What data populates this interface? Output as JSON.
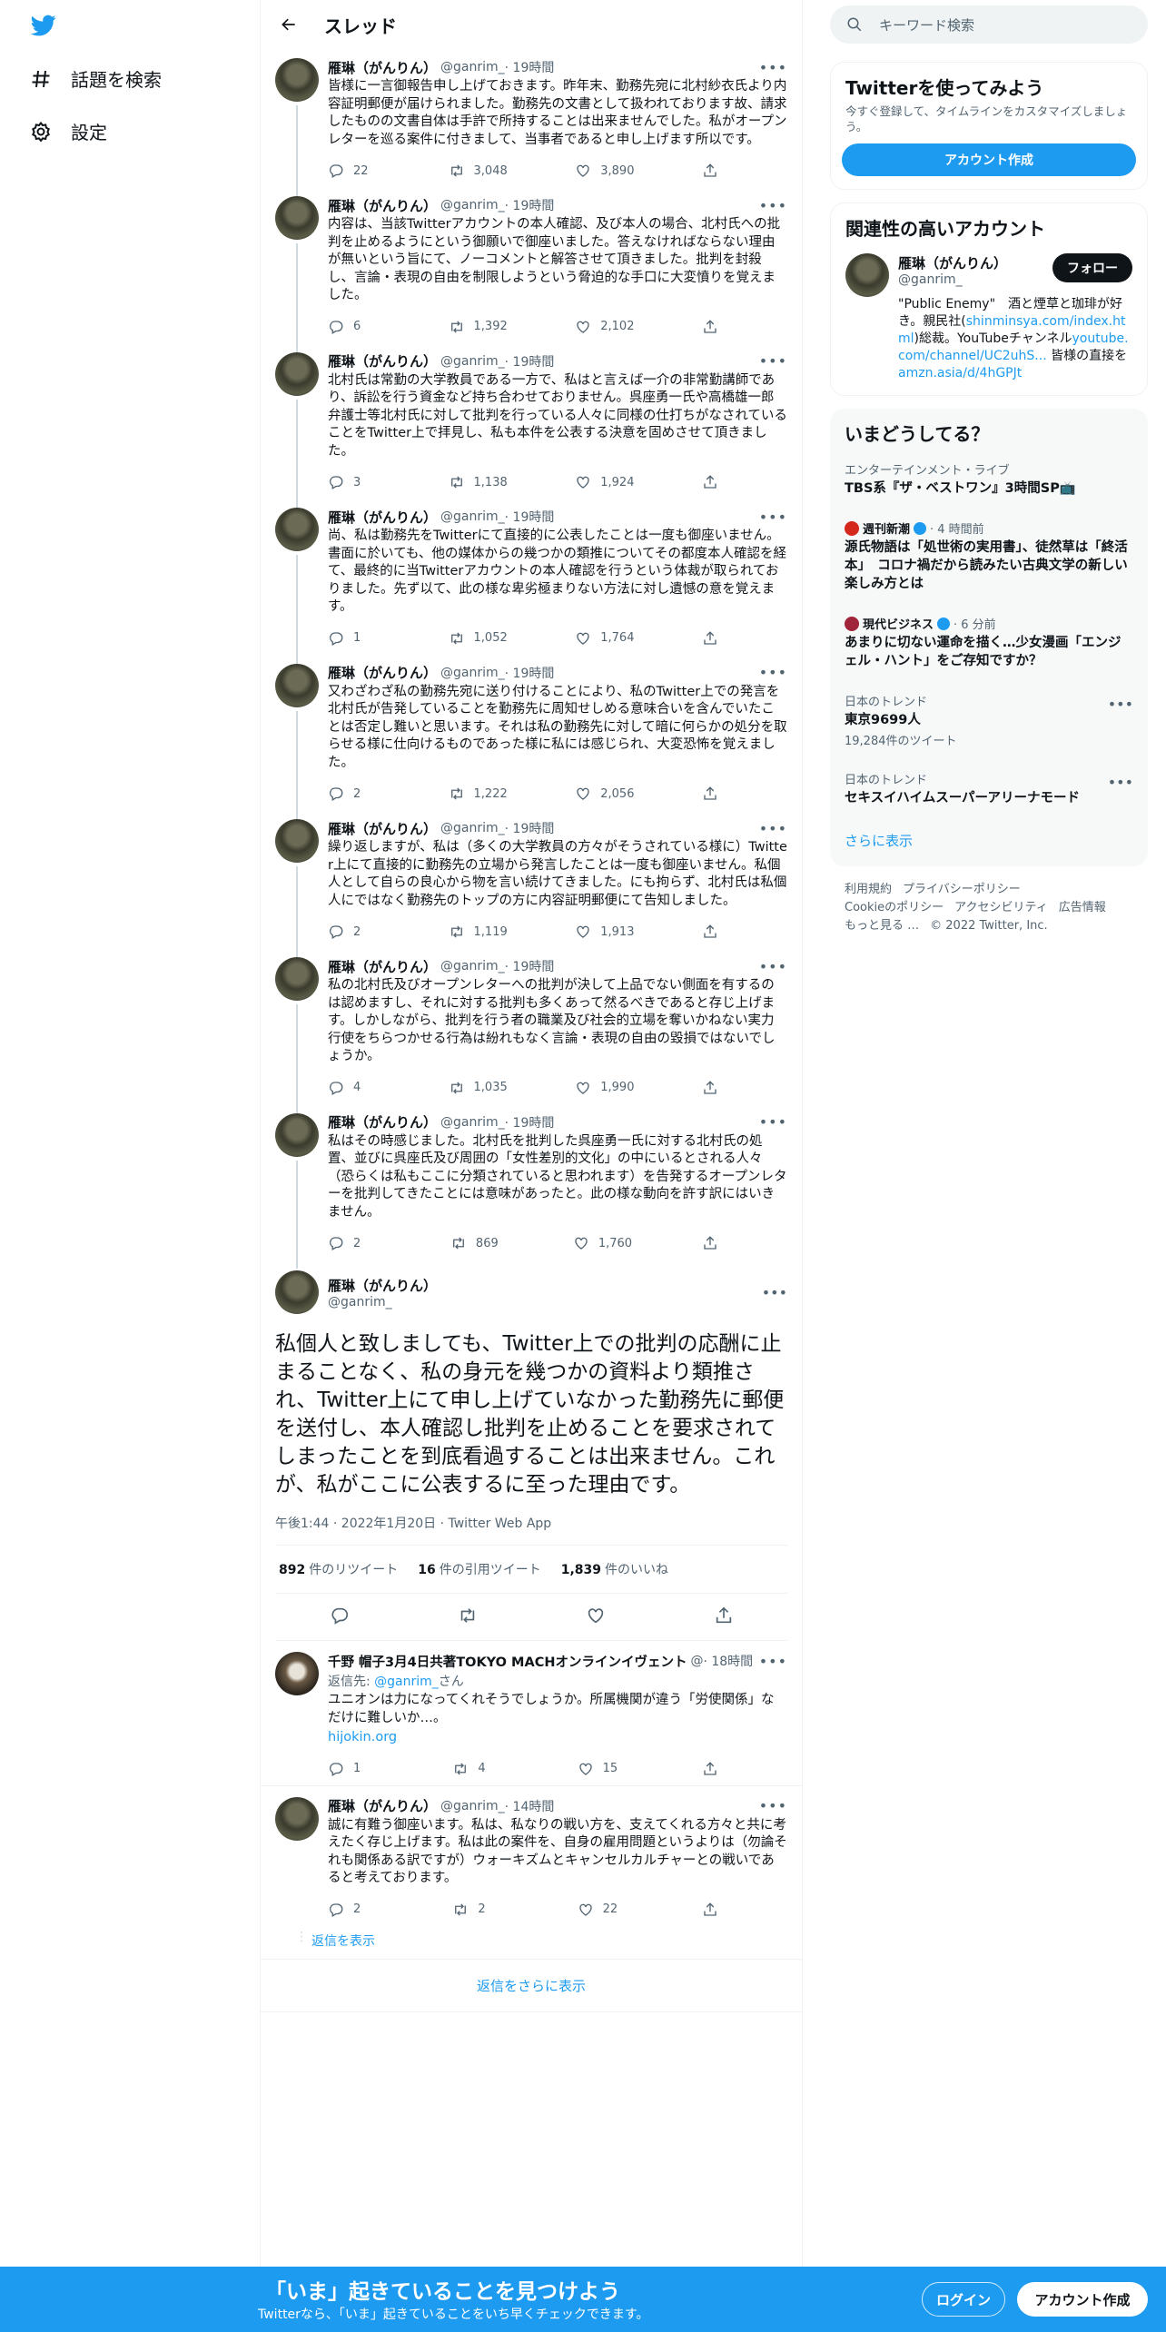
{
  "nav": {
    "explore": "話題を検索",
    "settings": "設定"
  },
  "header": {
    "title": "スレッド"
  },
  "thread": [
    {
      "name": "雁琳（がんりん）",
      "handle": "@ganrim_",
      "time": "· 19時間",
      "text": "皆様に一言御報告申し上げておきます。昨年末、勤務先宛に北村紗衣氏より内容証明郵便が届けられました。勤務先の文書として扱われております故、請求したものの文書自体は手許で所持することは出来ませんでした。私がオープンレターを巡る案件に付きまして、当事者であると申し上げます所以です。",
      "replies": "22",
      "retweets": "3,048",
      "likes": "3,890"
    },
    {
      "name": "雁琳（がんりん）",
      "handle": "@ganrim_",
      "time": "· 19時間",
      "text": "内容は、当該Twitterアカウントの本人確認、及び本人の場合、北村氏への批判を止めるようにという御願いで御座いました。答えなければならない理由が無いという旨にて、ノーコメントと解答させて頂きました。批判を封殺し、言論・表現の自由を制限しようという脅迫的な手口に大変憤りを覚えました。",
      "replies": "6",
      "retweets": "1,392",
      "likes": "2,102"
    },
    {
      "name": "雁琳（がんりん）",
      "handle": "@ganrim_",
      "time": "· 19時間",
      "text": "北村氏は常勤の大学教員である一方で、私はと言えば一介の非常勤講師であり、訴訟を行う資金など持ち合わせておりません。呉座勇一氏や高橋雄一郎弁護士等北村氏に対して批判を行っている人々に同様の仕打ちがなされていることをTwitter上で拝見し、私も本件を公表する決意を固めさせて頂きました。",
      "replies": "3",
      "retweets": "1,138",
      "likes": "1,924"
    },
    {
      "name": "雁琳（がんりん）",
      "handle": "@ganrim_",
      "time": "· 19時間",
      "text": "尚、私は勤務先をTwitterにて直接的に公表したことは一度も御座いません。書面に於いても、他の媒体からの幾つかの類推についてその都度本人確認を経て、最終的に当Twitterアカウントの本人確認を行うという体裁が取られておりました。先ず以て、此の様な卑劣極まりない方法に対し遺憾の意を覚えます。",
      "replies": "1",
      "retweets": "1,052",
      "likes": "1,764"
    },
    {
      "name": "雁琳（がんりん）",
      "handle": "@ganrim_",
      "time": "· 19時間",
      "text": "又わざわざ私の勤務先宛に送り付けることにより、私のTwitter上での発言を北村氏が告発していることを勤務先に周知せしめる意味合いを含んでいたことは否定し難いと思います。それは私の勤務先に対して暗に何らかの処分を取らせる様に仕向けるものであった様に私には感じられ、大変恐怖を覚えました。",
      "replies": "2",
      "retweets": "1,222",
      "likes": "2,056"
    },
    {
      "name": "雁琳（がんりん）",
      "handle": "@ganrim_",
      "time": "· 19時間",
      "text": "繰り返しますが、私は（多くの大学教員の方々がそうされている様に）Twitter上にて直接的に勤務先の立場から発言したことは一度も御座いません。私個人として自らの良心から物を言い続けてきました。にも拘らず、北村氏は私個人にではなく勤務先のトップの方に内容証明郵便にて告知しました。",
      "replies": "2",
      "retweets": "1,119",
      "likes": "1,913"
    },
    {
      "name": "雁琳（がんりん）",
      "handle": "@ganrim_",
      "time": "· 19時間",
      "text": "私の北村氏及びオープンレターへの批判が決して上品でない側面を有するのは認めますし、それに対する批判も多くあって然るべきであると存じ上げます。しかしながら、批判を行う者の職業及び社会的立場を奪いかねない実力行使をちらつかせる行為は紛れもなく言論・表現の自由の毀損ではないでしょうか。",
      "replies": "4",
      "retweets": "1,035",
      "likes": "1,990"
    },
    {
      "name": "雁琳（がんりん）",
      "handle": "@ganrim_",
      "time": "· 19時間",
      "text": "私はその時感じました。北村氏を批判した呉座勇一氏に対する北村氏の処置、並びに呉座氏及び周囲の「女性差別的文化」の中にいるとされる人々（恐らくは私もここに分類されていると思われます）を告発するオープンレターを批判してきたことには意味があったと。此の様な動向を許す訳にはいきません。",
      "replies": "2",
      "retweets": "869",
      "likes": "1,760"
    }
  ],
  "main_tweet": {
    "name": "雁琳（がんりん）",
    "handle": "@ganrim_",
    "text": "私個人と致しましても、Twitter上での批判の応酬に止まることなく、私の身元を幾つかの資料より類推され、Twitter上にて申し上げていなかった勤務先に郵便を送付し、本人確認し批判を止めることを要求されてしまったことを到底看過することは出来ません。これが、私がここに公表するに至った理由です。",
    "timestamp": "午後1:44 · 2022年1月20日 · Twitter Web App",
    "retweets_num": "892",
    "retweets_label": "件のリツイート",
    "quotes_num": "16",
    "quotes_label": "件の引用ツイート",
    "likes_num": "1,839",
    "likes_label": "件のいいね"
  },
  "replies": [
    {
      "name": "千野 帽子3月4日共著TOKYO MACHオンラインイヴェント",
      "handle": "@",
      "time": "· 18時間",
      "reply_to_prefix": "返信先: ",
      "reply_to_handle": "@ganrim_",
      "reply_to_suffix": "さん",
      "text": "ユニオンは力になってくれそうでしょうか。所属機関が違う「労使関係」なだけに難しいか…。",
      "link": "hijokin.org",
      "replies": "1",
      "retweets": "4",
      "likes": "15"
    },
    {
      "name": "雁琳（がんりん）",
      "handle": "@ganrim_",
      "time": "· 14時間",
      "text": "誠に有難う御座います。私は、私なりの戦い方を、支えてくれる方々と共に考えたく存じ上げます。私は此の案件を、自身の雇用問題というよりは（勿論それも関係ある訳ですが）ウォーキズムとキャンセルカルチャーとの戦いであると考えております。",
      "replies": "2",
      "retweets": "2",
      "likes": "22"
    }
  ],
  "show_replies": "返信を表示",
  "more_replies": "返信をさらに表示",
  "right": {
    "search_placeholder": "キーワード検索",
    "signup_title": "Twitterを使ってみよう",
    "signup_desc": "今すぐ登録して、タイムラインをカスタマイズしましょう。",
    "signup_button": "アカウント作成",
    "related_title": "関連性の高いアカウント",
    "related": {
      "name": "雁琳（がんりん）",
      "handle": "@ganrim_",
      "follow": "フォロー",
      "bio_1": "\"Public Enemy\"　酒と煙草と珈琲が好き。親民社(",
      "bio_link1": "shinminsya.com/index.html",
      "bio_2": ")総裁。YouTubeチャンネル",
      "bio_link2": "youtube.com/channel/UC2uhS...",
      "bio_3": " 皆様の直接を ",
      "bio_link3": "amzn.asia/d/4hGPJt"
    },
    "trends_title": "いまどうしてる？",
    "trends": [
      {
        "cat": "エンターテインメント・ライブ",
        "title": "TBS系『ザ・ベストワン』3時間SP📺"
      },
      {
        "src": "週刊新潮",
        "time": "· 4 時間前",
        "title": "源氏物語は「処世術の実用書」、徒然草は「終活本」　コロナ禍だから読みたい古典文学の新しい楽しみ方とは"
      },
      {
        "src": "現代ビジネス",
        "time": "· 6 分前",
        "title": "あまりに切ない運命を描く…少女漫画「エンジェル・ハント」をご存知ですか？"
      },
      {
        "cat": "日本のトレンド",
        "title": "東京9699人",
        "count": "19,284件のツイート"
      },
      {
        "cat": "日本のトレンド",
        "title": "セキスイハイムスーパーアリーナモード"
      }
    ],
    "show_more": "さらに表示",
    "footer": {
      "terms": "利用規約",
      "privacy": "プライバシーポリシー",
      "cookie": "Cookieのポリシー",
      "accessibility": "アクセシビリティ",
      "ads": "広告情報",
      "more": "もっと見る …",
      "copyright": "© 2022 Twitter, Inc."
    }
  },
  "bottom": {
    "title": "「いま」起きていることを見つけよう",
    "subtitle": "Twitterなら、「いま」起きていることをいち早くチェックできます。",
    "login": "ログイン",
    "signup": "アカウント作成"
  },
  "colors": {
    "accent": "#1d9bf0",
    "text": "#0f1419",
    "muted": "#536471"
  }
}
